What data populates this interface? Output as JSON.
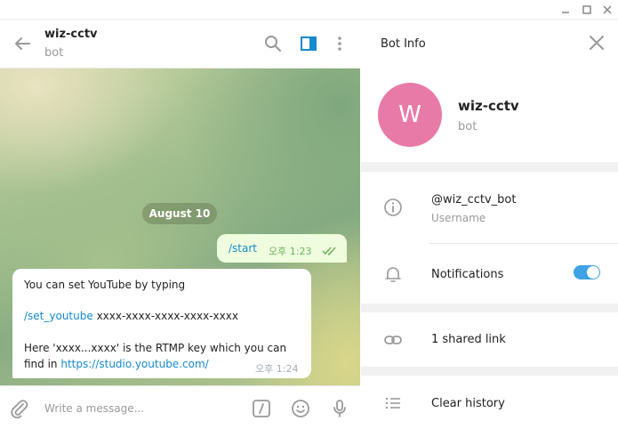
{
  "colors": {
    "accent": "#168acd",
    "out_bubble": "#effdde",
    "avatar": "#e87aa8",
    "toggle_on": "#3fa2e4"
  },
  "window": {
    "buttons": [
      "minimize-icon",
      "maximize-icon",
      "close-icon"
    ]
  },
  "chat": {
    "title": "wiz-cctv",
    "subtitle": "bot",
    "date": "August 10",
    "outgoing": {
      "text": "/start",
      "time": "오후 1:23",
      "status": "read-checks-icon"
    },
    "incoming": {
      "line1": "You can set YouTube by typing",
      "cmd": "/set_youtube",
      "cmd_rest": " xxxx-xxxx-xxxx-xxxx-xxxx",
      "line3": "Here 'xxxx...xxxx' is the RTMP key which you can",
      "line4_prefix": "find in ",
      "link": "https://studio.youtube.com/",
      "time": "오후 1:24"
    },
    "composer": {
      "placeholder": "Write a message..."
    }
  },
  "info": {
    "title": "Bot Info",
    "avatar_letter": "W",
    "name": "wiz-cctv",
    "subtitle": "bot",
    "username": "@wiz_cctv_bot",
    "username_label": "Username",
    "notifications_label": "Notifications",
    "notifications_on": true,
    "shared_link": "1 shared link",
    "clear_history": "Clear history"
  }
}
